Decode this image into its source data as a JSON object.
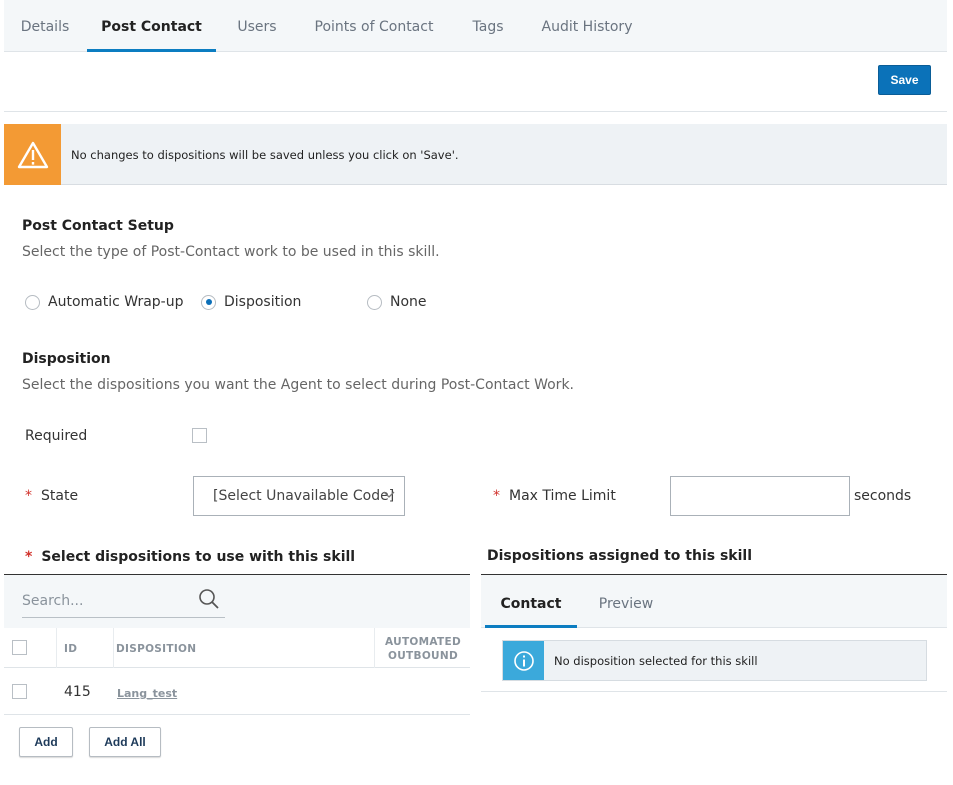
{
  "tabs": [
    {
      "label": "Details",
      "active": false
    },
    {
      "label": "Post Contact",
      "active": true
    },
    {
      "label": "Users",
      "active": false
    },
    {
      "label": "Points of Contact",
      "active": false
    },
    {
      "label": "Tags",
      "active": false
    },
    {
      "label": "Audit History",
      "active": false
    }
  ],
  "toolbar": {
    "save_label": "Save"
  },
  "warning": {
    "text": "No changes to dispositions will be saved unless you click on 'Save'.",
    "icon": "warning-triangle-icon",
    "color": "#f39a34"
  },
  "post_contact": {
    "title": "Post Contact Setup",
    "description": "Select the type of Post-Contact work to be used in this skill.",
    "options": [
      {
        "label": "Automatic Wrap-up",
        "selected": false
      },
      {
        "label": "Disposition",
        "selected": true
      },
      {
        "label": "None",
        "selected": false
      }
    ]
  },
  "disposition": {
    "title": "Disposition",
    "description": "Select the dispositions you want the Agent to select during Post-Contact Work.",
    "required_label": "Required",
    "required_checked": false,
    "state_label": "State",
    "state_value": "[Select Unavailable Code]",
    "max_time_label": "Max Time Limit",
    "max_time_value": "",
    "seconds_label": "seconds",
    "required_marker": "*"
  },
  "select_list": {
    "title": "Select dispositions to use with this skill",
    "search_placeholder": "Search...",
    "columns": {
      "id": "ID",
      "disposition": "DISPOSITION",
      "automated_line1": "AUTOMATED",
      "automated_line2": "OUTBOUND"
    },
    "rows": [
      {
        "id": "415",
        "disposition": "Lang_test"
      }
    ],
    "add_label": "Add",
    "add_all_label": "Add All"
  },
  "assigned": {
    "title": "Dispositions assigned to this skill",
    "tabs": [
      {
        "label": "Contact",
        "active": true
      },
      {
        "label": "Preview",
        "active": false
      }
    ],
    "empty_text": "No disposition selected for this skill",
    "accent": "#0c7dc1",
    "info_color": "#3ba9db"
  }
}
